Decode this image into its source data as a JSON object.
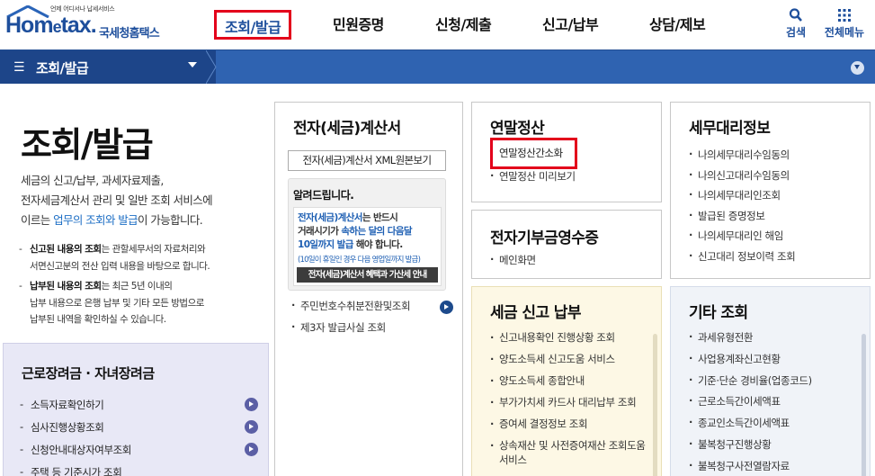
{
  "header": {
    "logo_sub": "언제 어디서나 납세서비스",
    "logo_word_1": "Hom",
    "logo_word_e": "e",
    "logo_word_2": "tax.",
    "logo_ko": "국세청홈택스",
    "nav": [
      "조회/발급",
      "민원증명",
      "신청/제출",
      "신고/납부",
      "상담/제보"
    ],
    "search_label": "검색",
    "menu_label": "전체메뉴"
  },
  "navbar": {
    "current_label": "조회/발급"
  },
  "intro": {
    "title": "조회/발급",
    "desc_1": "세금의 신고/납부, 과세자료제출,",
    "desc_2": "전자세금계산서 관리 및 일반 조회 서비스에",
    "desc_3a": "이르는 ",
    "desc_3b": "업무의 조회와 발급",
    "desc_3c": "이 가능합니다.",
    "note1_bold": "신고된 내용의 조회",
    "note1_text": "는 관할세무서의 자료처리와",
    "note1_text2": "서면신고분의 전산 입력 내용을 바탕으로 합니다.",
    "note2_bold": "납부된 내용의 조회",
    "note2_text": "는 최근 5년 이내의",
    "note2_text2": "납부 내용으로 은행 납부 및 기타 모든 방법으로",
    "note2_text3": "납부된 내역을 확인하실 수 있습니다."
  },
  "incentive": {
    "title": "근로장려금 · 자녀장려금",
    "items": [
      "소득자료확인하기",
      "심사진행상황조회",
      "신청안내대상자여부조회",
      "주택 등 기준시가 조회"
    ]
  },
  "tax_invoice": {
    "title": "전자(세금)계산서",
    "xml_button": "전자(세금)계산서 XML원본보기",
    "notice_title": "알려드립니다.",
    "notice_l1a": "전자(세금)계산서",
    "notice_l1b": "는 반드시",
    "notice_l2a": "거래시기가 ",
    "notice_l2b": "속하는 달의 다음달",
    "notice_l3a": "10일까지 발급",
    "notice_l3b": " 해야 합니다.",
    "notice_small": "(10일이 휴일인 경우 다음 영업일까지 발급)",
    "notice_button": "전자(세금)계산서 혜택과 가산세 안내",
    "items": [
      "주민번호수취분전환및조회",
      "제3자 발급사실 조회"
    ]
  },
  "year_end": {
    "title": "연말정산",
    "highlight_item": "연말정산간소화",
    "items": [
      "연말정산 미리보기"
    ]
  },
  "donation": {
    "title": "전자기부금영수증",
    "items": [
      "메인화면"
    ]
  },
  "filing": {
    "title": "세금 신고 납부",
    "items": [
      "신고내용확인 진행상황 조회",
      "양도소득세 신고도움 서비스",
      "양도소득세 종합안내",
      "부가가치세 카드사 대리납부 조회",
      "증여세 결정정보 조회",
      "상속재산 및 사전증여재산 조회도움 서비스"
    ]
  },
  "agent": {
    "title": "세무대리정보",
    "items": [
      "나의세무대리수임동의",
      "나의신고대리수임동의",
      "나의세무대리인조회",
      "발급된 증명정보",
      "나의세무대리인 해임",
      "신고대리 정보이력 조회"
    ]
  },
  "other": {
    "title": "기타 조회",
    "items": [
      "과세유형전환",
      "사업용계좌신고현황",
      "기준·단순 경비율(업종코드)",
      "근로소득간이세액표",
      "종교인소득간이세액표",
      "불복청구진행상황",
      "불복청구사전열람자료"
    ]
  },
  "colors": {
    "brand_blue": "#1e4f9c",
    "nav_blue": "#2f63b1",
    "highlight_red": "#e3001b"
  }
}
